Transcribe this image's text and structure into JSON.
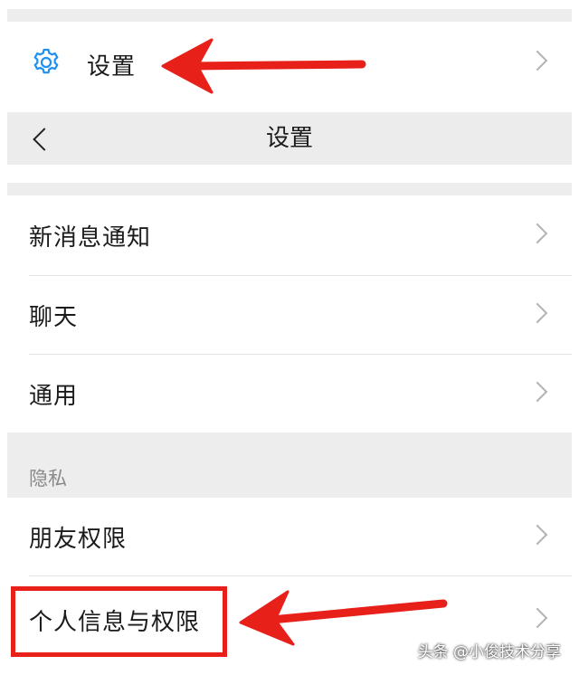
{
  "top_item": {
    "label": "设置",
    "icon": "gear-icon",
    "icon_color": "#1f8ff0"
  },
  "nav": {
    "title": "设置",
    "back_icon": "chevron-left-icon"
  },
  "group1": [
    {
      "label": "新消息通知"
    },
    {
      "label": "聊天"
    },
    {
      "label": "通用"
    }
  ],
  "privacy": {
    "section_label": "隐私",
    "items": [
      {
        "label": "朋友权限"
      },
      {
        "label": "个人信息与权限"
      }
    ]
  },
  "annotation": {
    "color": "#e8201a"
  },
  "watermark": "头条 @小俊技术分享"
}
